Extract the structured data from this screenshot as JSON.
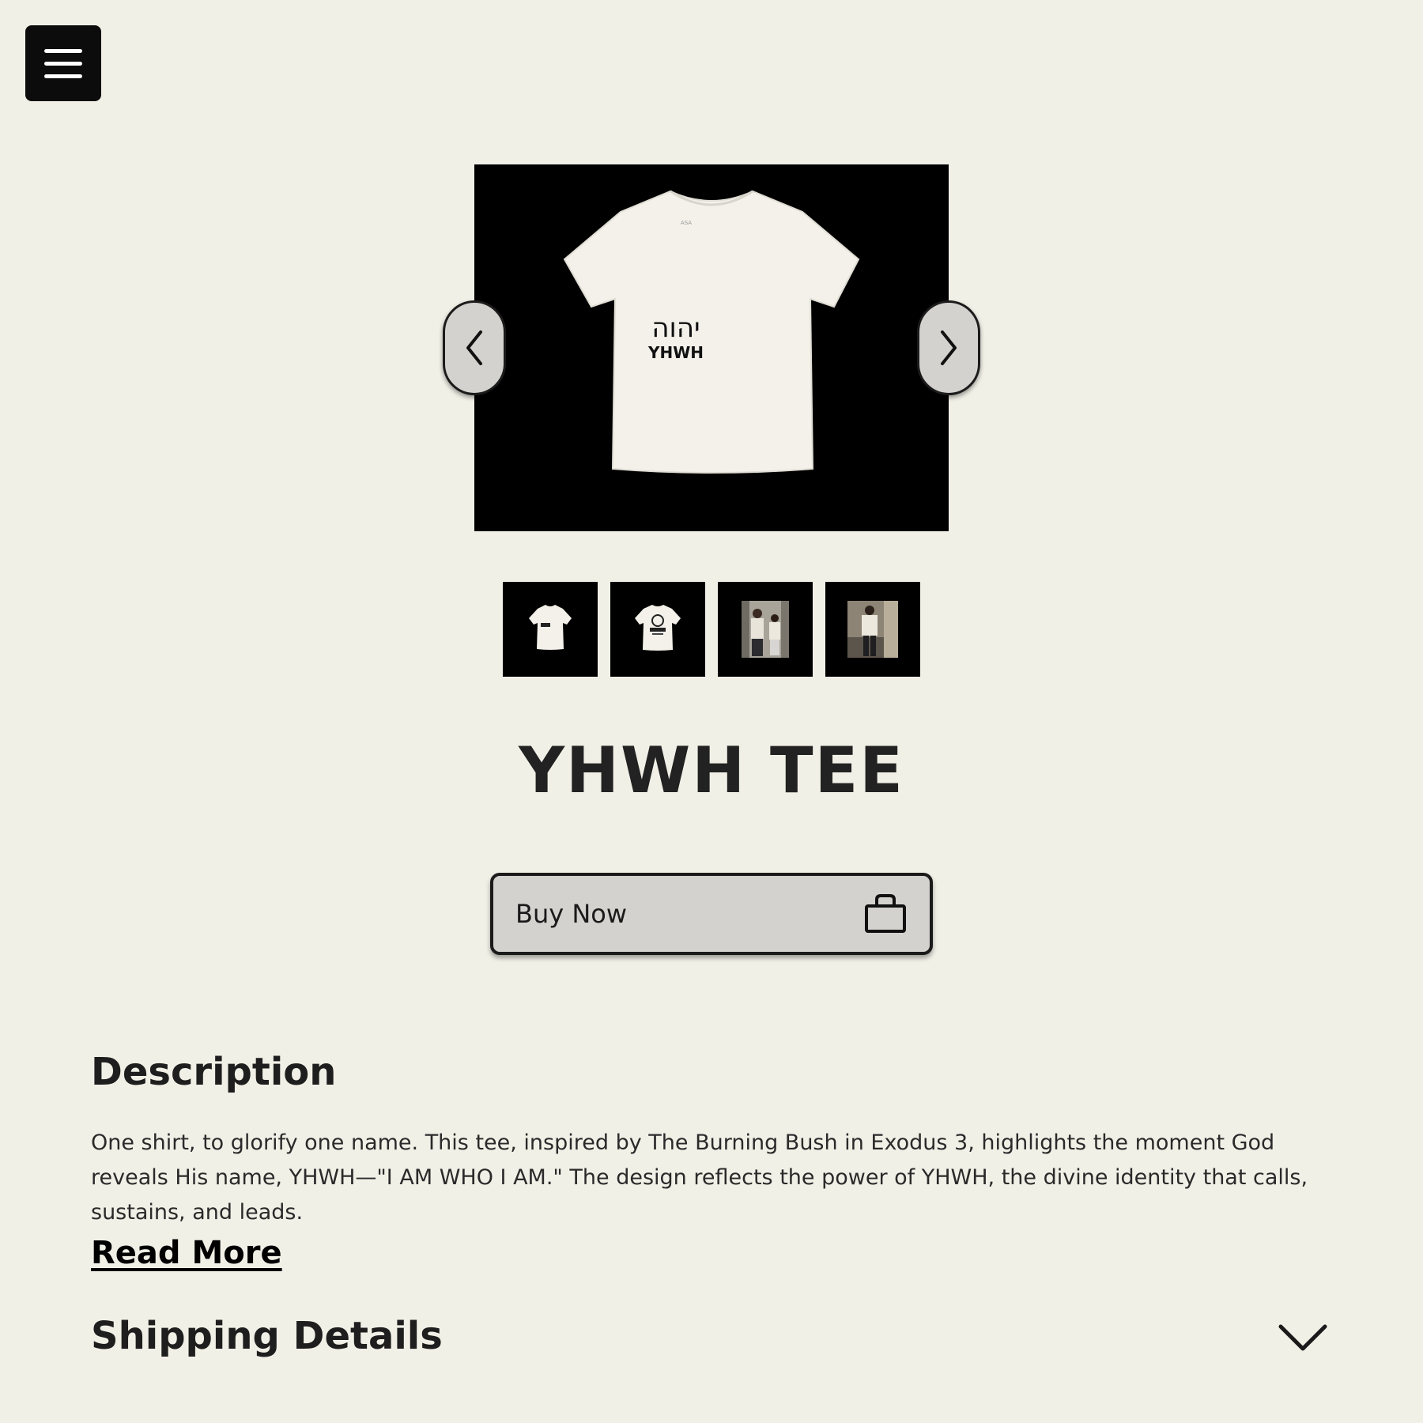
{
  "header": {
    "menu_icon": "hamburger-menu-icon"
  },
  "gallery": {
    "prev_icon": "chevron-left-icon",
    "next_icon": "chevron-right-icon",
    "main_image": {
      "icon": "tshirt-image",
      "print_hebrew": "יהוה",
      "print_text": "YHWH"
    },
    "thumbnails": [
      "tee-front",
      "tee-back",
      "models-photo-1",
      "models-photo-2"
    ]
  },
  "product": {
    "title": "YHWH TEE",
    "buy_label": "Buy Now",
    "buy_icon": "shopping-bag-icon"
  },
  "description": {
    "heading": "Description",
    "text": "One shirt, to glorify one name. This tee, inspired by The Burning Bush in Exodus 3, highlights the moment God reveals His name, YHWH—\"I AM WHO I AM.\" The design reflects the power of YHWH, the divine identity that calls, sustains, and leads.",
    "read_more": "Read More"
  },
  "shipping": {
    "heading": "Shipping Details",
    "icon": "chevron-down-icon"
  },
  "colors": {
    "background": "#f1f0e7",
    "button_bg": "#d3d2cf",
    "dark": "#0c0c0c"
  }
}
